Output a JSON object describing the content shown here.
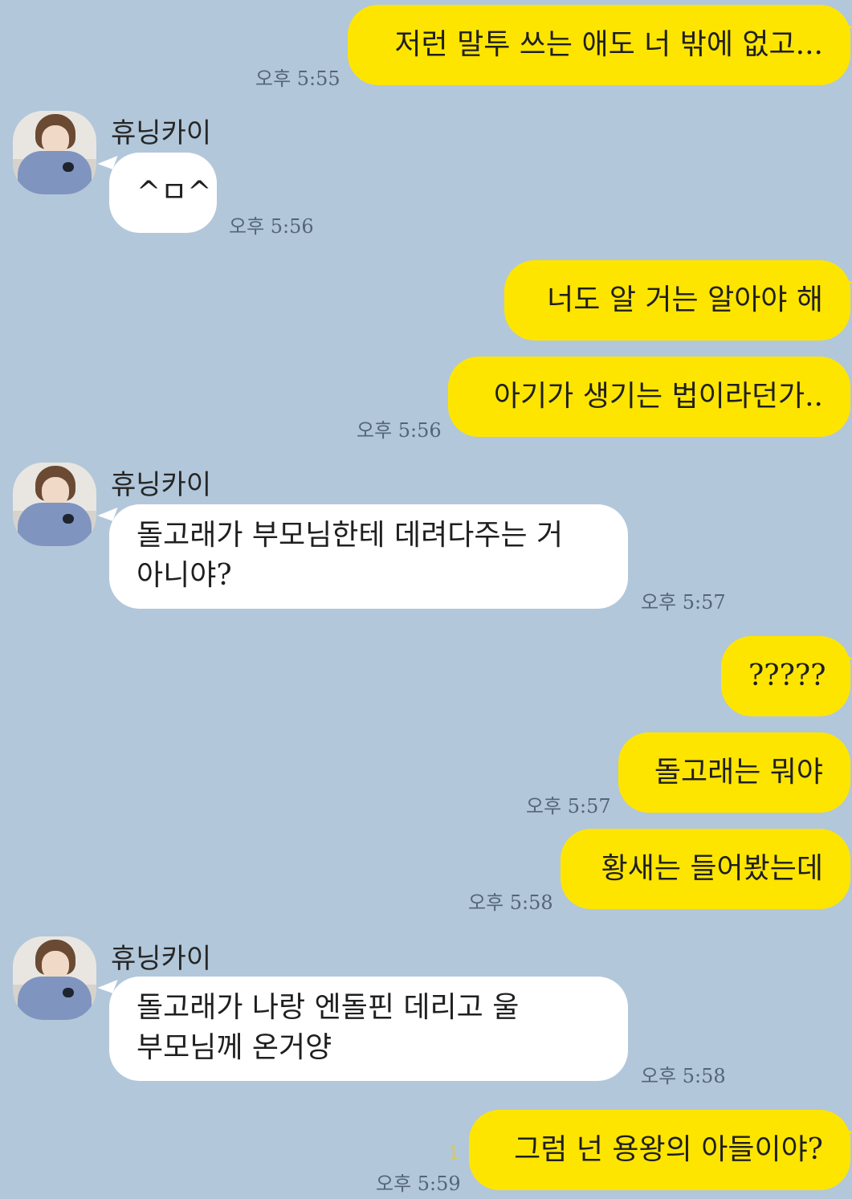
{
  "contact": {
    "name": "휴닝카이"
  },
  "messages": [
    {
      "text": "저런 말투 쓰는 애도 너 밖에 없고...",
      "time": "오후 5:55"
    },
    {
      "text": "^ㅁ^",
      "time": "오후 5:56"
    },
    {
      "text": "너도 알 거는 알아야 해"
    },
    {
      "text": "아기가 생기는 법이라던가..",
      "time": "오후 5:56"
    },
    {
      "line1": "돌고래가 부모님한테 데려다주는 거",
      "line2": "아니야?",
      "time": "오후 5:57"
    },
    {
      "text": "?????"
    },
    {
      "text": "돌고래는 뭐야",
      "time": "오후 5:57"
    },
    {
      "text": "황새는 들어봤는데",
      "time": "오후 5:58"
    },
    {
      "line1": "돌고래가 나랑 엔돌핀 데리고 울",
      "line2": "부모님께 온거양",
      "time": "오후 5:58"
    },
    {
      "text": "그럼 넌 용왕의 아들이야?",
      "time": "오후 5:59",
      "unread": "1"
    }
  ]
}
